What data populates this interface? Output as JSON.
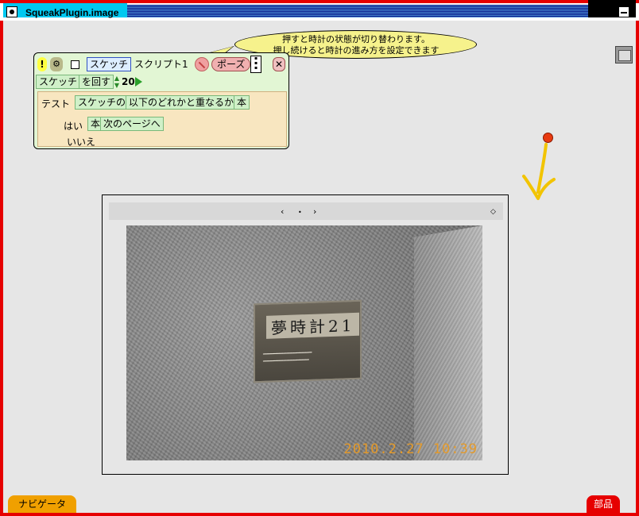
{
  "window": {
    "title": "SqueakPlugin.image"
  },
  "balloon": {
    "line1": "押すと時計の状態が切り替わります。",
    "line2": "押し続けると時計の進み方を設定できます"
  },
  "script": {
    "bang": "!",
    "object_tile": "スケッチ",
    "script_name": "スクリプト1",
    "pause_label": "ポーズ",
    "close_label": "✕",
    "row2": {
      "object_tile": "スケッチ",
      "verb": "を回す",
      "value": "20"
    },
    "test": {
      "test_label": "テスト",
      "subject_tile": "スケッチの",
      "condition_tile": "以下のどれかと重なるか",
      "book_tile": "本",
      "yes_label": "はい",
      "yes_book_tile": "本",
      "yes_action_tile": "次のページへ",
      "no_label": "いいえ"
    }
  },
  "photo_viewer": {
    "prev": "‹",
    "dot": "•",
    "next": "›",
    "menu": "◇",
    "plaque_title": "夢時計21",
    "timestamp": "2010.2.27 10:39"
  },
  "flaps": {
    "navigator": "ナビゲータ",
    "parts": "部品"
  },
  "colors": {
    "frame": "#e60000",
    "title_tab": "#00c8f0",
    "balloon": "#f6f28c",
    "script_bg": "#e2f6d4"
  }
}
